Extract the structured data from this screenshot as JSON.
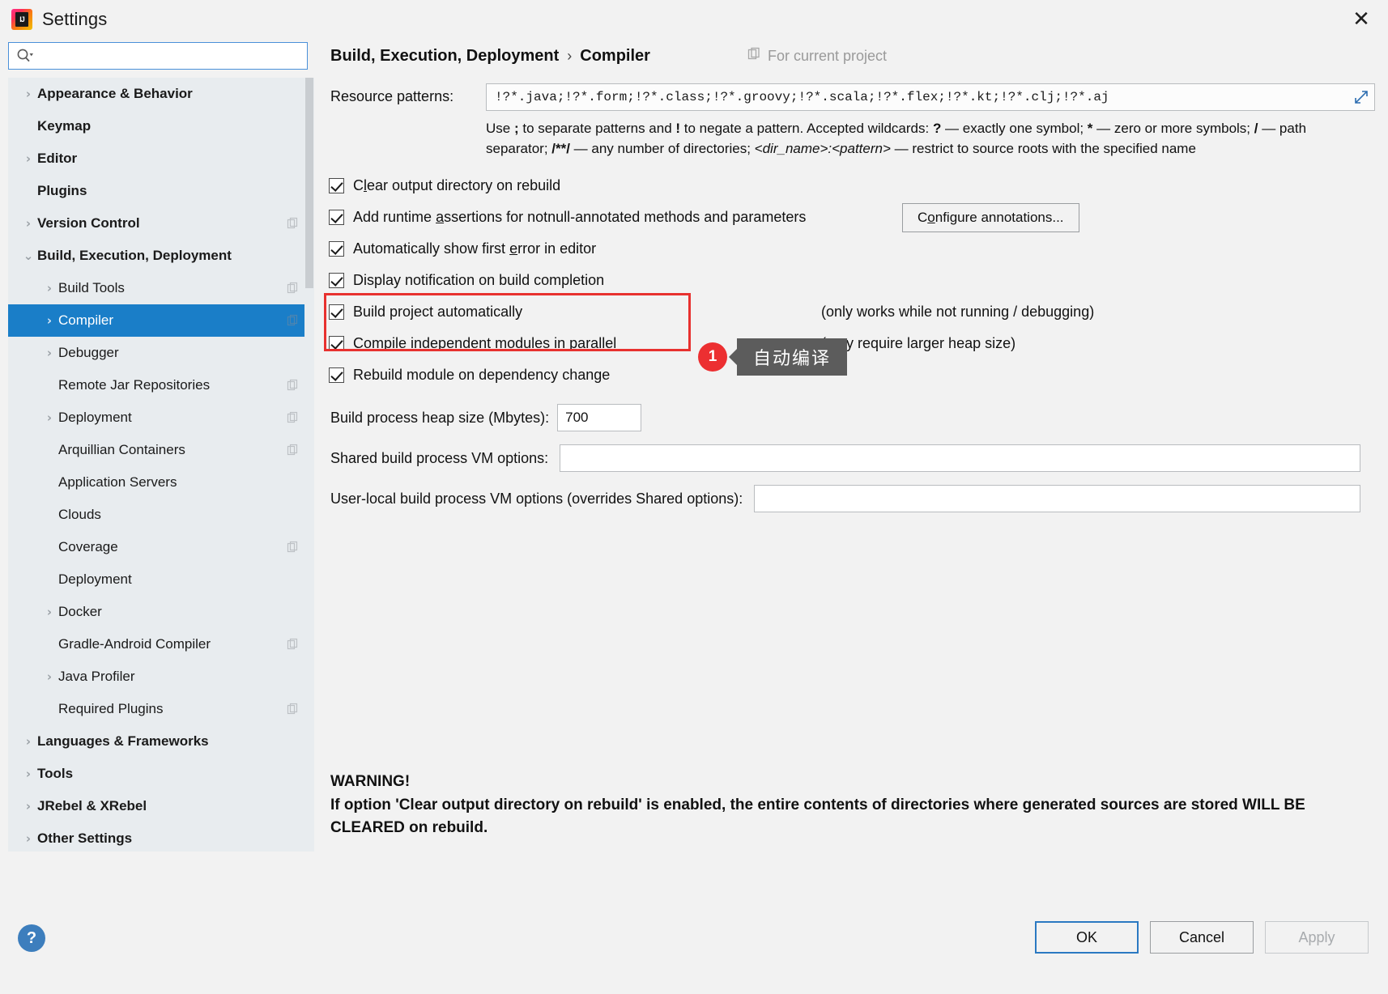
{
  "window": {
    "title": "Settings",
    "close_label": "✕",
    "logo_text": "IJ"
  },
  "search": {
    "value": "",
    "placeholder": "",
    "icon": "search-icon"
  },
  "sidebar": {
    "items": [
      {
        "label": "Appearance & Behavior",
        "level": 0,
        "arrow": "collapsed",
        "project_icon": false,
        "selected": false
      },
      {
        "label": "Keymap",
        "level": 0,
        "arrow": "none",
        "project_icon": false,
        "selected": false
      },
      {
        "label": "Editor",
        "level": 0,
        "arrow": "collapsed",
        "project_icon": false,
        "selected": false
      },
      {
        "label": "Plugins",
        "level": 0,
        "arrow": "none",
        "project_icon": false,
        "selected": false
      },
      {
        "label": "Version Control",
        "level": 0,
        "arrow": "collapsed",
        "project_icon": true,
        "selected": false
      },
      {
        "label": "Build, Execution, Deployment",
        "level": 0,
        "arrow": "expanded",
        "project_icon": false,
        "selected": false
      },
      {
        "label": "Build Tools",
        "level": 1,
        "arrow": "collapsed",
        "project_icon": true,
        "selected": false
      },
      {
        "label": "Compiler",
        "level": 1,
        "arrow": "collapsed",
        "project_icon": true,
        "selected": true
      },
      {
        "label": "Debugger",
        "level": 1,
        "arrow": "collapsed",
        "project_icon": false,
        "selected": false
      },
      {
        "label": "Remote Jar Repositories",
        "level": 1,
        "arrow": "none",
        "project_icon": true,
        "selected": false
      },
      {
        "label": "Deployment",
        "level": 1,
        "arrow": "collapsed",
        "project_icon": true,
        "selected": false
      },
      {
        "label": "Arquillian Containers",
        "level": 1,
        "arrow": "none",
        "project_icon": true,
        "selected": false
      },
      {
        "label": "Application Servers",
        "level": 1,
        "arrow": "none",
        "project_icon": false,
        "selected": false
      },
      {
        "label": "Clouds",
        "level": 1,
        "arrow": "none",
        "project_icon": false,
        "selected": false
      },
      {
        "label": "Coverage",
        "level": 1,
        "arrow": "none",
        "project_icon": true,
        "selected": false
      },
      {
        "label": "Deployment",
        "level": 1,
        "arrow": "none",
        "project_icon": false,
        "selected": false
      },
      {
        "label": "Docker",
        "level": 1,
        "arrow": "collapsed",
        "project_icon": false,
        "selected": false
      },
      {
        "label": "Gradle-Android Compiler",
        "level": 1,
        "arrow": "none",
        "project_icon": true,
        "selected": false
      },
      {
        "label": "Java Profiler",
        "level": 1,
        "arrow": "collapsed",
        "project_icon": false,
        "selected": false
      },
      {
        "label": "Required Plugins",
        "level": 1,
        "arrow": "none",
        "project_icon": true,
        "selected": false
      },
      {
        "label": "Languages & Frameworks",
        "level": 0,
        "arrow": "collapsed",
        "project_icon": false,
        "selected": false
      },
      {
        "label": "Tools",
        "level": 0,
        "arrow": "collapsed",
        "project_icon": false,
        "selected": false
      },
      {
        "label": "JRebel & XRebel",
        "level": 0,
        "arrow": "collapsed",
        "project_icon": false,
        "selected": false
      },
      {
        "label": "Other Settings",
        "level": 0,
        "arrow": "collapsed",
        "project_icon": false,
        "selected": false
      }
    ]
  },
  "main": {
    "breadcrumb_root": "Build, Execution, Deployment",
    "breadcrumb_sep": "›",
    "breadcrumb_leaf": "Compiler",
    "scope_note": "For current project",
    "resource_patterns_label": "Resource patterns:",
    "resource_patterns_value": "!?*.java;!?*.form;!?*.class;!?*.groovy;!?*.scala;!?*.flex;!?*.kt;!?*.clj;!?*.aj",
    "hint_line1_a": "Use ",
    "hint_semicolon": ";",
    "hint_line1_b": " to separate patterns and ",
    "hint_bang": "!",
    "hint_line1_c": " to negate a pattern. Accepted wildcards: ",
    "hint_question": "?",
    "hint_line1_d": " — exactly one symbol; ",
    "hint_star": "*",
    "hint_line1_e": " — zero or more symbols; ",
    "hint_slash": "/",
    "hint_line2_a": " — path separator; ",
    "hint_globstar": "/**/",
    "hint_line2_b": " — any number of directories; ",
    "hint_dirpattern": "<dir_name>:<pattern>",
    "hint_line2_c": " — restrict to source roots with the specified name",
    "checkboxes": [
      {
        "label_pre": "C",
        "label_mnemonic": "l",
        "label_post": "ear output directory on rebuild",
        "checked": true,
        "note": ""
      },
      {
        "label_pre": "Add runtime ",
        "label_mnemonic": "a",
        "label_post": "ssertions for notnull-annotated methods and parameters",
        "checked": true,
        "note": ""
      },
      {
        "label_pre": "Automatically show first ",
        "label_mnemonic": "e",
        "label_post": "rror in editor",
        "checked": true,
        "note": ""
      },
      {
        "label_pre": "Display notification on build completion",
        "label_mnemonic": "",
        "label_post": "",
        "checked": true,
        "note": ""
      },
      {
        "label_pre": "Build project automatically",
        "label_mnemonic": "",
        "label_post": "",
        "checked": true,
        "note": "(only works while not running / debugging)"
      },
      {
        "label_pre": "Compile independent modules in parallel",
        "label_mnemonic": "",
        "label_post": "",
        "checked": true,
        "note": "(may require larger heap size)"
      },
      {
        "label_pre": "Rebuild module on dependency change",
        "label_mnemonic": "",
        "label_post": "",
        "checked": true,
        "note": ""
      }
    ],
    "configure_annotations_pre": "C",
    "configure_annotations_mnemonic": "o",
    "configure_annotations_post": "nfigure annotations...",
    "annotation_badge": "1",
    "annotation_tooltip": "自动编译",
    "heap_label": "Build process heap size (Mbytes):",
    "heap_value": "700",
    "shared_vm_label": "Shared build process VM options:",
    "shared_vm_value": "",
    "userlocal_vm_label": "User-local build process VM options (overrides Shared options):",
    "userlocal_vm_value": "",
    "warning_title": "WARNING!",
    "warning_body": "If option 'Clear output directory on rebuild' is enabled, the entire contents of directories where generated sources are stored WILL BE CLEARED on rebuild."
  },
  "footer": {
    "help_label": "?",
    "ok_label": "OK",
    "cancel_label": "Cancel",
    "apply_label": "Apply"
  },
  "colors": {
    "accent": "#1a7ec8",
    "annotation_red": "#e8312f",
    "tooltip_bg": "#5c5c5c",
    "sidebar_bg": "#e8ecef"
  }
}
